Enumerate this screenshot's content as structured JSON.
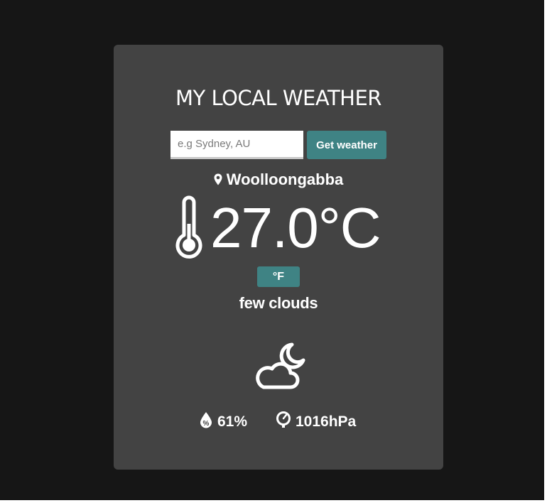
{
  "app": {
    "title": "MY LOCAL WEATHER"
  },
  "search": {
    "placeholder": "e.g Sydney, AU",
    "value": "",
    "button_label": "Get weather"
  },
  "location": {
    "icon": "map-pin-icon",
    "name": "Woolloongabba"
  },
  "temperature": {
    "icon": "thermometer-icon",
    "value": "27.0°C",
    "toggle_label": "°F"
  },
  "condition": {
    "text": "few clouds",
    "icon": "night-partly-cloudy-icon"
  },
  "stats": {
    "humidity": {
      "icon": "humidity-icon",
      "value": "61%"
    },
    "pressure": {
      "icon": "barometer-icon",
      "value": "1016hPa"
    }
  },
  "colors": {
    "page_background": "#161616",
    "card_background": "#434343",
    "accent": "#3f8384",
    "text": "#ffffff"
  }
}
